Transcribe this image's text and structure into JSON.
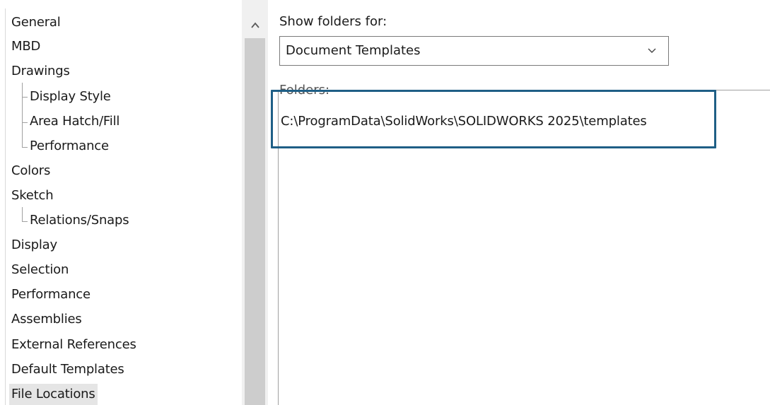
{
  "tree": {
    "items": [
      {
        "label": "General",
        "level": 0
      },
      {
        "label": "MBD",
        "level": 0
      },
      {
        "label": "Drawings",
        "level": 0
      },
      {
        "label": "Display Style",
        "level": 1
      },
      {
        "label": "Area Hatch/Fill",
        "level": 1
      },
      {
        "label": "Performance",
        "level": 1
      },
      {
        "label": "Colors",
        "level": 0
      },
      {
        "label": "Sketch",
        "level": 0
      },
      {
        "label": "Relations/Snaps",
        "level": 1
      },
      {
        "label": "Display",
        "level": 0
      },
      {
        "label": "Selection",
        "level": 0
      },
      {
        "label": "Performance",
        "level": 0
      },
      {
        "label": "Assemblies",
        "level": 0
      },
      {
        "label": "External References",
        "level": 0
      },
      {
        "label": "Default Templates",
        "level": 0
      },
      {
        "label": "File Locations",
        "level": 0,
        "selected": true
      }
    ]
  },
  "scrollbar": {
    "up_icon": "chevron-up-icon"
  },
  "main": {
    "show_folders_label": "Show folders for:",
    "show_folders_value": "Document Templates",
    "dropdown_icon": "chevron-down-icon",
    "folders_label": "Folders:",
    "folders": [
      "C:\\ProgramData\\SolidWorks\\SOLIDWORKS 2025\\templates"
    ]
  },
  "colors": {
    "highlight_border": "#1f5f86",
    "selected_background": "#e5e5e5"
  }
}
